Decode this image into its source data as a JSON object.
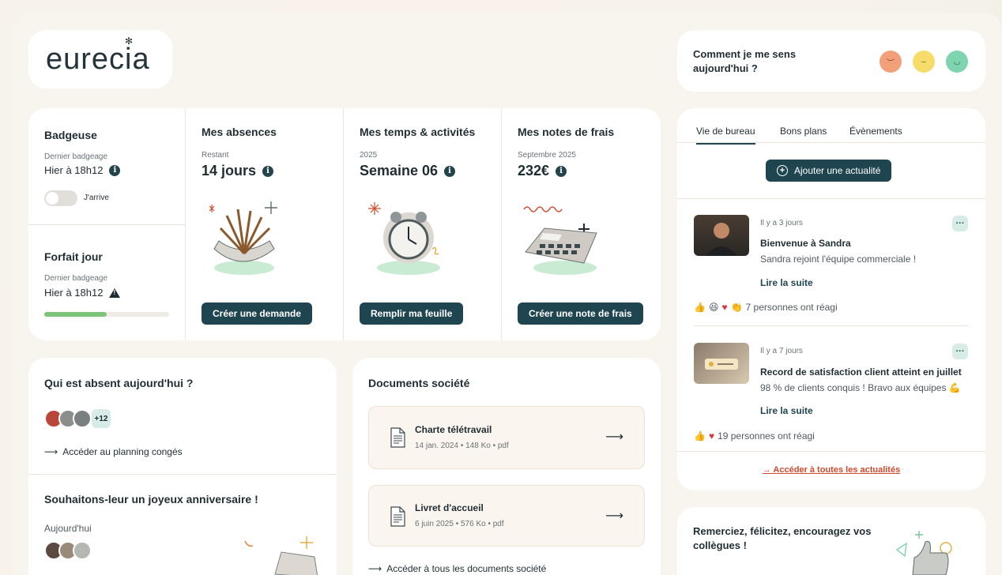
{
  "brand": {
    "logo_text": "eurecia",
    "accent": "#1f4550",
    "alert": "#d04a2e"
  },
  "mood": {
    "title": "Comment je me sens aujourd'hui ?",
    "faces": [
      {
        "icon": "sad-face-icon",
        "color": "#f2a07a"
      },
      {
        "icon": "neutral-face-icon",
        "color": "#f6dc6a"
      },
      {
        "icon": "happy-face-icon",
        "color": "#7fd4b0"
      }
    ]
  },
  "badgeuse": {
    "title": "Badgeuse",
    "last_label": "Dernier badgeage",
    "last_value": "Hier à 18h12",
    "toggle_label": "J'arrive"
  },
  "forfait": {
    "title": "Forfait jour",
    "last_label": "Dernier badgeage",
    "last_value": "Hier à 18h12",
    "progress": 0.5
  },
  "absences": {
    "title": "Mes absences",
    "sub": "Restant",
    "value": "14 jours",
    "button": "Créer une demande"
  },
  "temps": {
    "title": "Mes temps & activités",
    "sub": "2025",
    "value": "Semaine 06",
    "button": "Remplir ma feuille"
  },
  "frais": {
    "title": "Mes notes de frais",
    "sub": "Septembre 2025",
    "value": "232€",
    "button": "Créer une note de frais"
  },
  "absent_today": {
    "title": "Qui est absent aujourd'hui ?",
    "more": "+12",
    "link": "Accéder au planning congés"
  },
  "birthday": {
    "title": "Souhaitons-leur un joyeux anniversaire !",
    "day": "Aujourd'hui"
  },
  "documents": {
    "title": "Documents société",
    "items": [
      {
        "name": "Charte télétravail",
        "meta": "14 jan. 2024 • 148 Ko • pdf"
      },
      {
        "name": "Livret d'accueil",
        "meta": "6 juin 2025 • 576 Ko • pdf"
      }
    ],
    "link": "Accéder à tous les documents société"
  },
  "news": {
    "tabs": [
      "Vie de bureau",
      "Bons plans",
      "Évènements"
    ],
    "add_button": "Ajouter une actualité",
    "items": [
      {
        "time": "Il y a 3 jours",
        "title": "Bienvenue à Sandra",
        "text": "Sandra rejoint l'équipe commerciale !",
        "read_more": "Lire la suite",
        "reactions": "7 personnes ont réagi"
      },
      {
        "time": "Il y a 7 jours",
        "title": "Record de satisfaction client atteint en juillet",
        "text": "98 % de clients conquis ! Bravo aux équipes 💪",
        "read_more": "Lire la suite",
        "reactions": "19 personnes ont réagi"
      }
    ],
    "all_link": "→ Accéder à toutes les actualités"
  },
  "thanks": {
    "title": "Remerciez, félicitez, encouragez vos collègues !"
  }
}
